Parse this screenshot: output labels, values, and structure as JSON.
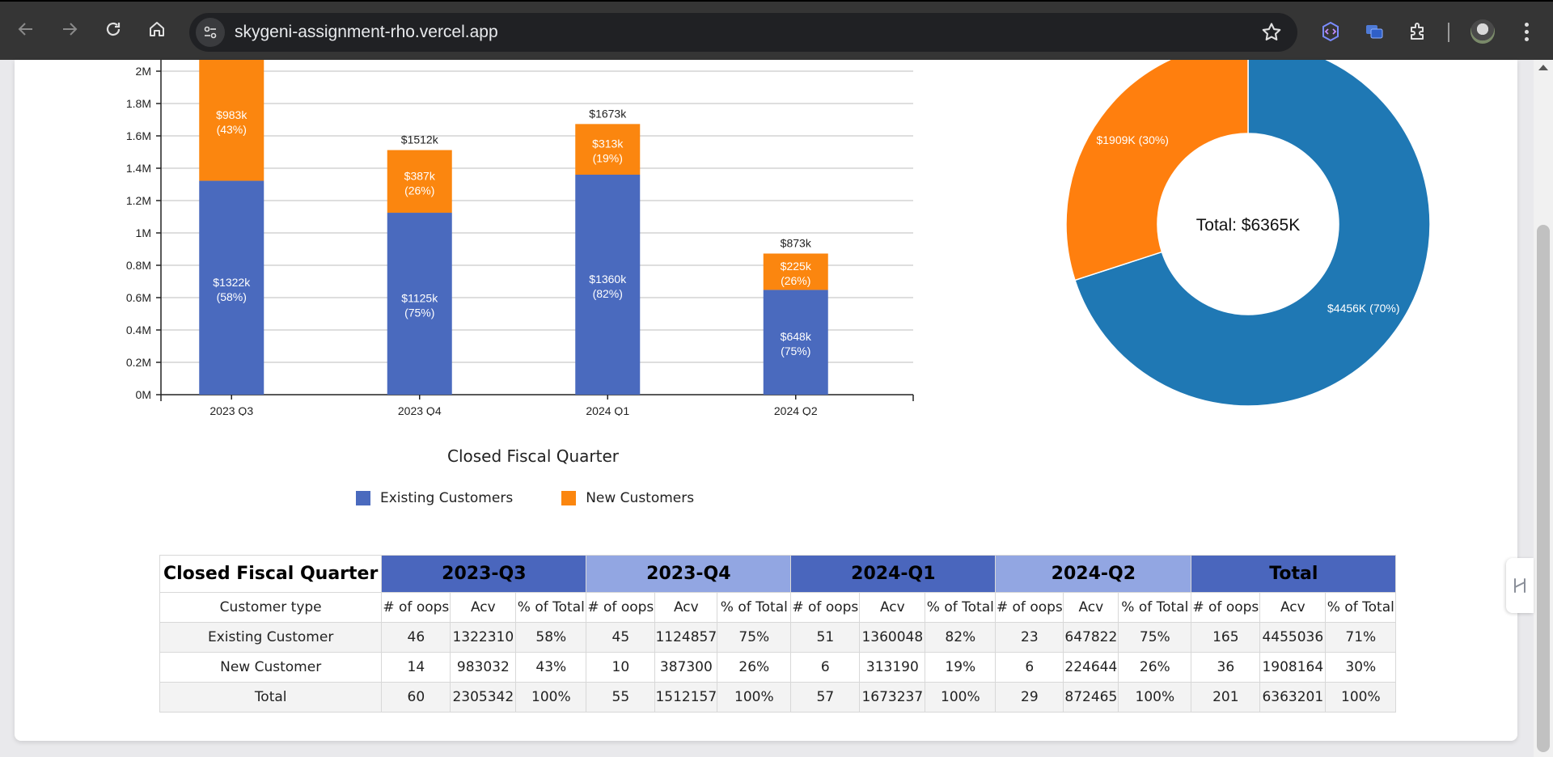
{
  "browser": {
    "url": "skygeni-assignment-rho.vercel.app"
  },
  "chart_data": [
    {
      "type": "bar",
      "stacked": true,
      "categories": [
        "2023 Q3",
        "2023 Q4",
        "2024 Q1",
        "2024 Q2"
      ],
      "series": [
        {
          "name": "Existing Customers",
          "values": [
            1322310,
            1124857,
            1360048,
            647822
          ],
          "labels": [
            "$1322k",
            "$1125k",
            "$1360k",
            "$648k"
          ],
          "pct_labels": [
            "(58%)",
            "(75%)",
            "(82%)",
            "(75%)"
          ],
          "color": "#4a6abe"
        },
        {
          "name": "New Customers",
          "values": [
            983032,
            387300,
            313190,
            224644
          ],
          "labels": [
            "$983k",
            "$387k",
            "$313k",
            "$225k"
          ],
          "pct_labels": [
            "(43%)",
            "(26%)",
            "(19%)",
            "(26%)"
          ],
          "color": "#fb860f"
        }
      ],
      "totals": [
        "",
        "$1512k",
        "$1673k",
        "$873k"
      ],
      "y_ticks": [
        "0M",
        "0.2M",
        "0.4M",
        "0.6M",
        "0.8M",
        "1M",
        "1.2M",
        "1.4M",
        "1.6M",
        "1.8M",
        "2M"
      ],
      "ylim": [
        0,
        2000000
      ],
      "xlabel": "Closed Fiscal Quarter",
      "grid": true,
      "legend": "bottom"
    },
    {
      "type": "pie",
      "donut": true,
      "center_label": "Total: $6365K",
      "slices": [
        {
          "name": "Existing",
          "value": 4456,
          "label": "$4456K (70%)",
          "color": "#1f78b4"
        },
        {
          "name": "New",
          "value": 1909,
          "label": "$1909K (30%)",
          "color": "#ff7f0e"
        }
      ]
    }
  ],
  "legend": {
    "items": [
      {
        "label": "Existing Customers",
        "color": "#4a6abe"
      },
      {
        "label": "New Customers",
        "color": "#fb860f"
      }
    ]
  },
  "table": {
    "corner": "Closed Fiscal Quarter",
    "groups": [
      "2023-Q3",
      "2023-Q4",
      "2024-Q1",
      "2024-Q2",
      "Total"
    ],
    "row_header_label": "Customer type",
    "subheaders": [
      "# of oops",
      "Acv",
      "% of Total"
    ],
    "rows": [
      {
        "label": "Existing Customer",
        "cells": [
          "46",
          "1322310",
          "58%",
          "45",
          "1124857",
          "75%",
          "51",
          "1360048",
          "82%",
          "23",
          "647822",
          "75%",
          "165",
          "4455036",
          "71%"
        ]
      },
      {
        "label": "New Customer",
        "cells": [
          "14",
          "983032",
          "43%",
          "10",
          "387300",
          "26%",
          "6",
          "313190",
          "19%",
          "6",
          "224644",
          "26%",
          "36",
          "1908164",
          "30%"
        ]
      },
      {
        "label": "Total",
        "cells": [
          "60",
          "2305342",
          "100%",
          "55",
          "1512157",
          "100%",
          "57",
          "1673237",
          "100%",
          "29",
          "872465",
          "100%",
          "201",
          "6363201",
          "100%"
        ]
      }
    ]
  }
}
